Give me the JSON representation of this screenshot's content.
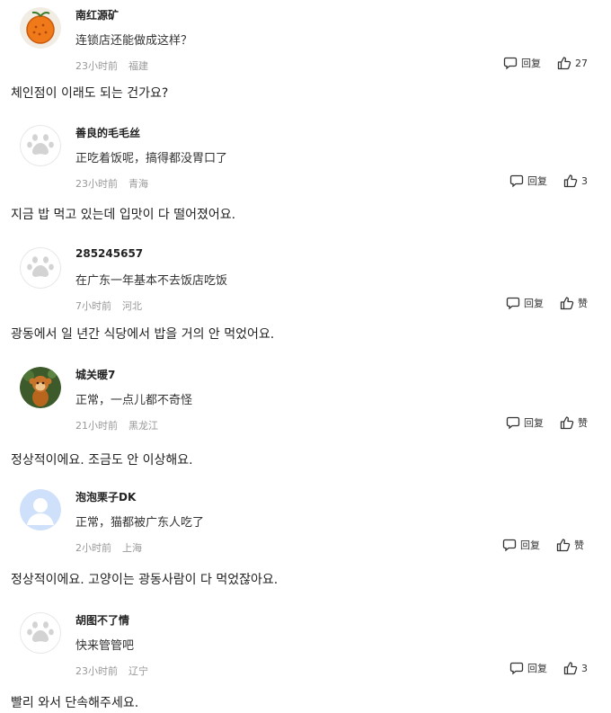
{
  "comments": [
    {
      "username": "南红源矿",
      "avatar": "orange-fruit-avatar",
      "text": "连锁店还能做成这样？",
      "time": "23小时前",
      "location": "福建",
      "reply_label": "回复",
      "like_label": "27",
      "translation": "체인점이 이래도 되는 건가요?"
    },
    {
      "username": "善良的毛毛丝",
      "avatar": "default-paw-avatar",
      "text": "正吃着饭呢，搞得都没胃口了",
      "time": "23小时前",
      "location": "青海",
      "reply_label": "回复",
      "like_label": "3",
      "translation": "지금 밥 먹고 있는데 입맛이 다 떨어졌어요."
    },
    {
      "username": "285245657",
      "avatar": "default-paw-avatar",
      "text": "在广东一年基本不去饭店吃饭",
      "time": "7小时前",
      "location": "河北",
      "reply_label": "回复",
      "like_label": "赞",
      "translation": "광동에서 일 년간 식당에서 밥을 거의 안 먹었어요."
    },
    {
      "username": "城关暖7",
      "avatar": "monkey-avatar",
      "text": "正常，一点儿都不奇怪",
      "time": "21小时前",
      "location": "黑龙江",
      "reply_label": "回复",
      "like_label": "赞",
      "translation": "정상적이에요. 조금도 안 이상해요."
    },
    {
      "username": "泡泡栗子DK",
      "avatar": "default-person-avatar",
      "text": "正常，猫都被广东人吃了",
      "time": "2小时前",
      "location": "上海",
      "reply_label": "回复",
      "like_label": "赞",
      "translation": "정상적이에요. 고양이는 광동사람이 다 먹었잖아요."
    },
    {
      "username": "胡图不了情",
      "avatar": "default-paw-avatar",
      "text": "快来管管吧",
      "time": "23小时前",
      "location": "辽宁",
      "reply_label": "回复",
      "like_label": "3",
      "translation": "빨리 와서 단속해주세요."
    }
  ],
  "colors": {
    "meta": "#999999",
    "text": "#333333",
    "username": "#222222"
  }
}
